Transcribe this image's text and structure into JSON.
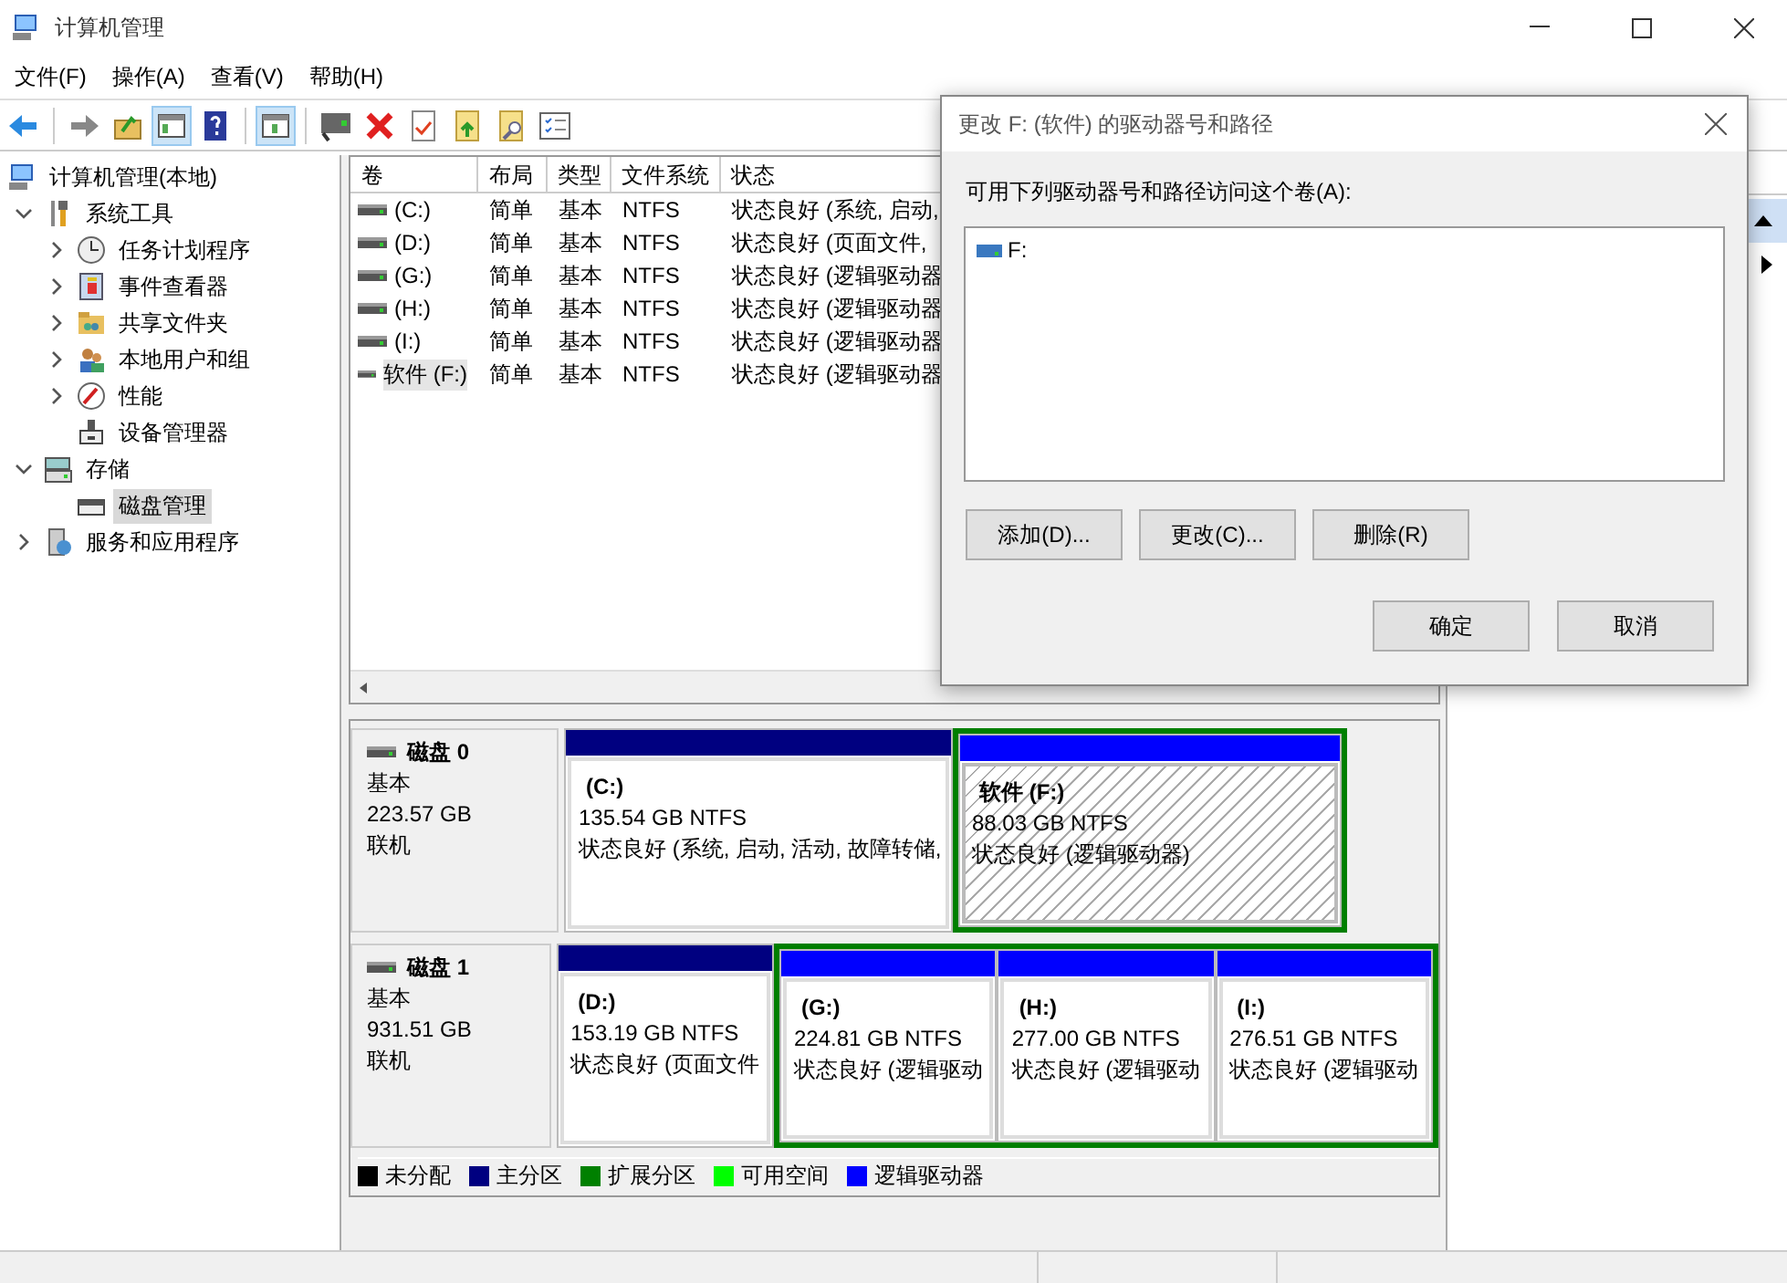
{
  "window": {
    "title": "计算机管理"
  },
  "menu": [
    {
      "label": "文件(F)"
    },
    {
      "label": "操作(A)"
    },
    {
      "label": "查看(V)"
    },
    {
      "label": "帮助(H)"
    }
  ],
  "toolbar": [
    {
      "pressed": false
    },
    {
      "pressed": false
    },
    {
      "pressed": false
    },
    {
      "pressed": true
    },
    {
      "pressed": false
    },
    {
      "pressed": true
    },
    {
      "pressed": false
    },
    {
      "pressed": false
    },
    {
      "pressed": false
    },
    {
      "pressed": false
    },
    {
      "pressed": false
    },
    {
      "pressed": false
    }
  ],
  "tree": [
    {
      "label": "计算机管理(本地)",
      "selected": false,
      "children": [
        {
          "label": "系统工具",
          "expanded": true,
          "selected": false,
          "children": [
            {
              "label": "任务计划程序",
              "expanded": false,
              "selected": false
            },
            {
              "label": "事件查看器",
              "expanded": false,
              "selected": false
            },
            {
              "label": "共享文件夹",
              "expanded": false,
              "selected": false
            },
            {
              "label": "本地用户和组",
              "expanded": false,
              "selected": false
            },
            {
              "label": "性能",
              "expanded": false,
              "selected": false
            },
            {
              "label": "设备管理器",
              "selected": false
            }
          ]
        },
        {
          "label": "存储",
          "expanded": true,
          "selected": false,
          "children": [
            {
              "label": "磁盘管理",
              "selected": true
            }
          ]
        },
        {
          "label": "服务和应用程序",
          "expanded": false,
          "selected": false
        }
      ]
    }
  ],
  "table": {
    "columns": [
      "卷",
      "布局",
      "类型",
      "文件系统",
      "状态"
    ],
    "rows": [
      {
        "volume": "(C:)",
        "layout": "简单",
        "type": "基本",
        "file_system": "NTFS",
        "status": "状态良好 (系统, 启动,",
        "selected": false
      },
      {
        "volume": "(D:)",
        "layout": "简单",
        "type": "基本",
        "file_system": "NTFS",
        "status": "状态良好 (页面文件,",
        "selected": false
      },
      {
        "volume": "(G:)",
        "layout": "简单",
        "type": "基本",
        "file_system": "NTFS",
        "status": "状态良好 (逻辑驱动器",
        "selected": false
      },
      {
        "volume": "(H:)",
        "layout": "简单",
        "type": "基本",
        "file_system": "NTFS",
        "status": "状态良好 (逻辑驱动器",
        "selected": false
      },
      {
        "volume": "(I:)",
        "layout": "简单",
        "type": "基本",
        "file_system": "NTFS",
        "status": "状态良好 (逻辑驱动器",
        "selected": false
      },
      {
        "volume": "软件 (F:)",
        "layout": "简单",
        "type": "基本",
        "file_system": "NTFS",
        "status": "状态良好 (逻辑驱动器",
        "selected": true
      }
    ]
  },
  "disks": [
    {
      "name": "磁盘 0",
      "type": "基本",
      "size": "223.57 GB",
      "status": "联机",
      "partitions": [
        {
          "kind": "primary",
          "extended": false,
          "label": "(C:)",
          "size": "135.54 GB NTFS",
          "status": "状态良好 (系统, 启动, 活动, 故障转储,",
          "selected": false
        },
        {
          "kind": "logical",
          "extended": true,
          "label": "软件  (F:)",
          "size": "88.03 GB NTFS",
          "status": "状态良好 (逻辑驱动器)",
          "selected": true
        }
      ]
    },
    {
      "name": "磁盘 1",
      "type": "基本",
      "size": "931.51 GB",
      "status": "联机",
      "partitions": [
        {
          "kind": "primary",
          "extended": false,
          "label": "(D:)",
          "size": "153.19 GB NTFS",
          "status": "状态良好 (页面文件",
          "selected": false
        },
        {
          "kind": "logical",
          "extended": true,
          "label": "(G:)",
          "size": "224.81 GB NTFS",
          "status": "状态良好 (逻辑驱动",
          "selected": false
        },
        {
          "kind": "logical",
          "extended": true,
          "label": "(H:)",
          "size": "277.00 GB NTFS",
          "status": "状态良好 (逻辑驱动",
          "selected": false
        },
        {
          "kind": "logical",
          "extended": true,
          "label": "(I:)",
          "size": "276.51 GB NTFS",
          "status": "状态良好 (逻辑驱动",
          "selected": false
        }
      ]
    }
  ],
  "legend": [
    {
      "label": "未分配",
      "color": "#000000"
    },
    {
      "label": "主分区",
      "color": "#000080"
    },
    {
      "label": "扩展分区",
      "color": "#008000"
    },
    {
      "label": "可用空间",
      "color": "#00ff00"
    },
    {
      "label": "逻辑驱动器",
      "color": "#0000ff"
    }
  ],
  "dialog": {
    "title": "更改 F: (软件) 的驱动器号和路径",
    "prompt": "可用下列驱动器号和路径访问这个卷(A):",
    "items": [
      {
        "label": "F:"
      }
    ],
    "buttons": [
      "添加(D)...",
      "更改(C)...",
      "删除(R)"
    ],
    "ok": "确定",
    "cancel": "取消"
  }
}
